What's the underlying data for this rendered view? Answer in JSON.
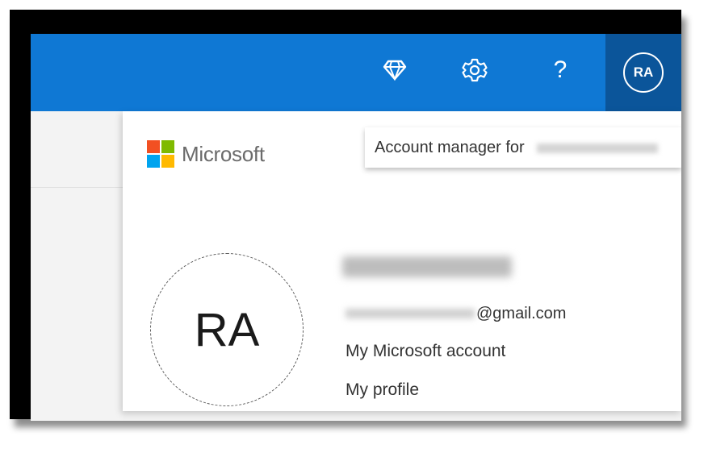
{
  "topbar": {
    "icons": [
      "diamond-icon",
      "gear-icon",
      "help-icon"
    ],
    "help_glyph": "?",
    "account_initials": "RA",
    "color": "#0f78d4",
    "account_color": "#0b559a"
  },
  "flyout": {
    "brand": "Microsoft",
    "brand_colors": [
      "#f25022",
      "#7fba00",
      "#00a4ef",
      "#ffb900"
    ],
    "header_label": "Account manager for",
    "initials": "RA",
    "email_domain": "@gmail.com",
    "links": [
      "My Microsoft account",
      "My profile"
    ]
  }
}
